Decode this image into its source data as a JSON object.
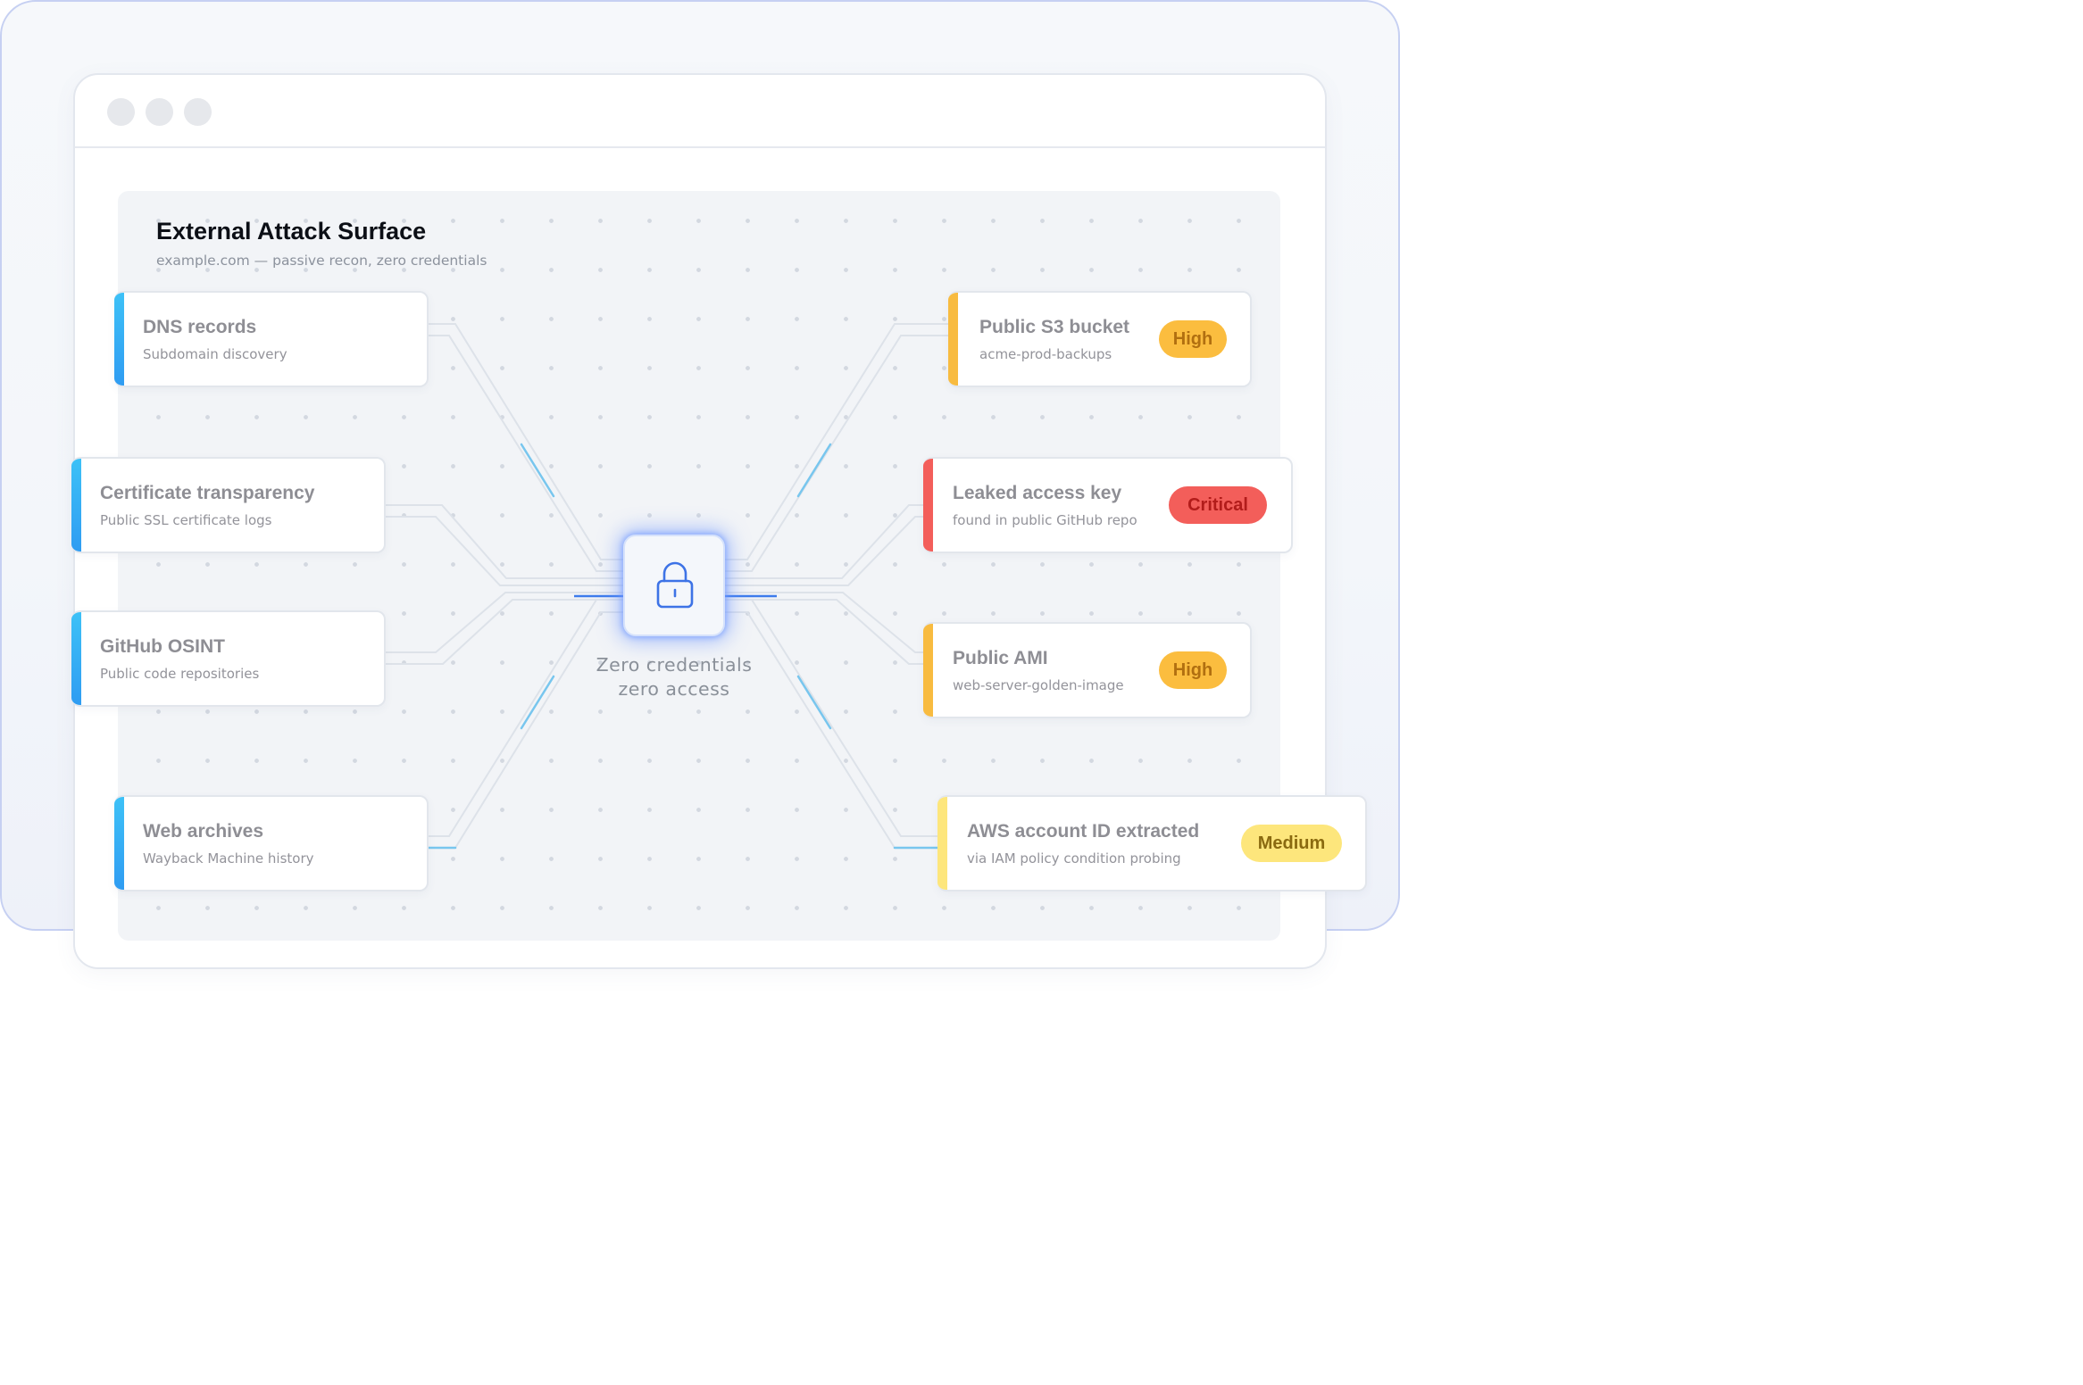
{
  "diagram": {
    "title": "External Attack Surface",
    "subtitle": "example.com — passive recon, zero credentials",
    "center": {
      "icon": "lock-icon",
      "line1": "Zero credentials",
      "line2": "zero access"
    },
    "sources": [
      {
        "title": "DNS records",
        "subtitle": "Subdomain discovery"
      },
      {
        "title": "Certificate transparency",
        "subtitle": "Public SSL certificate logs"
      },
      {
        "title": "GitHub OSINT",
        "subtitle": "Public code repositories"
      },
      {
        "title": "Web archives",
        "subtitle": "Wayback Machine history"
      }
    ],
    "findings": [
      {
        "title": "Public S3 bucket",
        "subtitle": "acme-prod-backups",
        "severity": "High"
      },
      {
        "title": "Leaked access key",
        "subtitle": "found in public GitHub repo",
        "severity": "Critical"
      },
      {
        "title": "Public AMI",
        "subtitle": "web-server-golden-image",
        "severity": "High"
      },
      {
        "title": "AWS account ID extracted",
        "subtitle": "via IAM policy condition probing",
        "severity": "Medium"
      }
    ]
  },
  "colors": {
    "source_accent": "#36b3f5",
    "high": "#fbbd3f",
    "critical": "#f35e5a",
    "medium": "#fde67c",
    "glow": "#6e96ff",
    "connector": "#dde2e9",
    "connector_active": "#78c6ee"
  }
}
